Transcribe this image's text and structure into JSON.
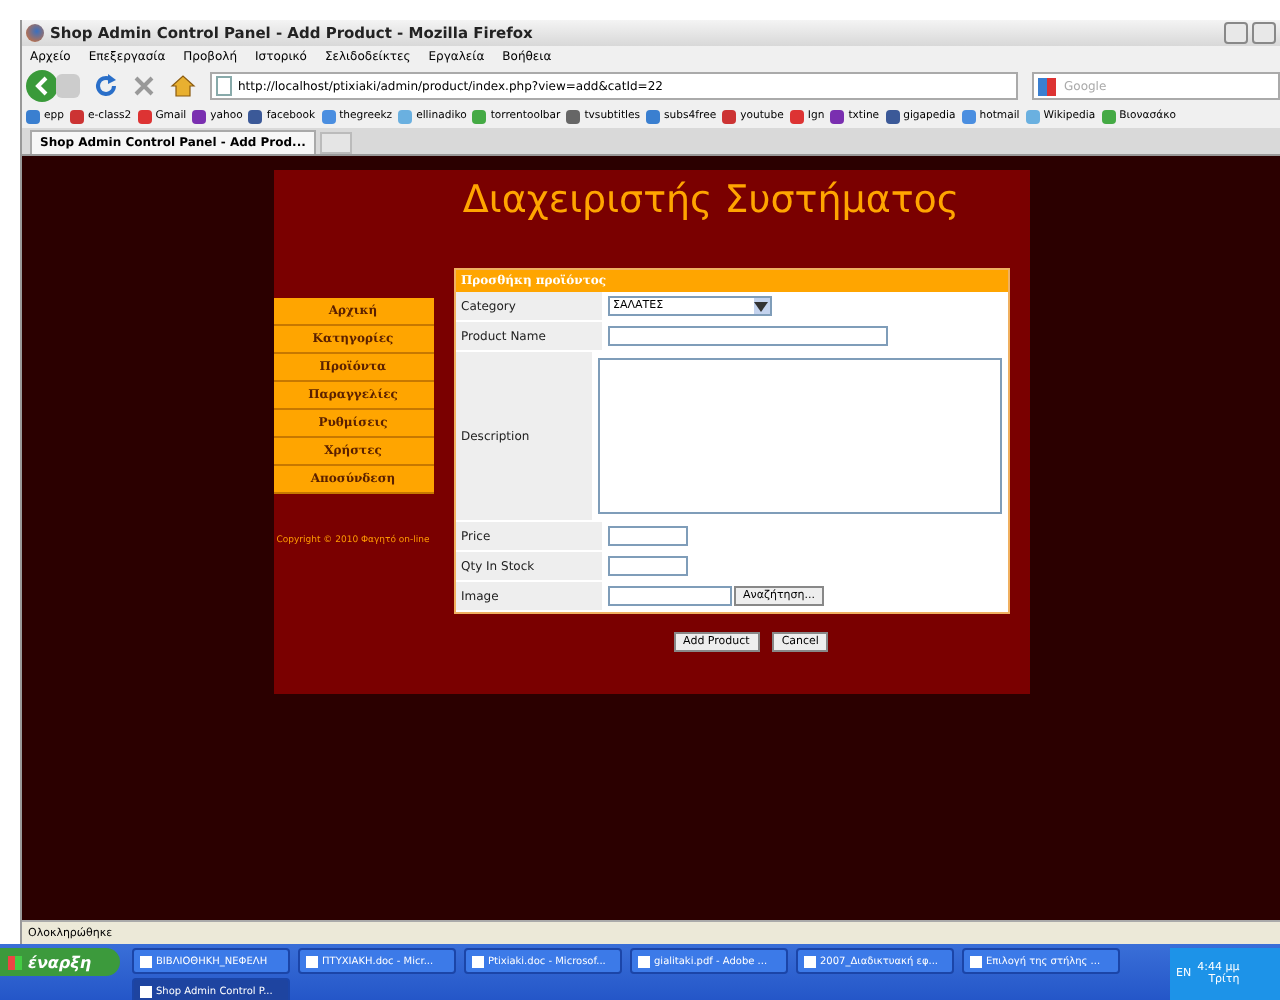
{
  "window": {
    "title": "Shop Admin Control Panel - Add Product - Mozilla Firefox"
  },
  "menu": [
    "Αρχείο",
    "Επεξεργασία",
    "Προβολή",
    "Ιστορικό",
    "Σελιδοδείκτες",
    "Εργαλεία",
    "Βοήθεια"
  ],
  "address": "http://localhost/ptixiaki/admin/product/index.php?view=add&catId=22",
  "search": {
    "placeholder": "Google"
  },
  "bookmarks": [
    "epp",
    "e-class2",
    "Gmail",
    "yahoo",
    "facebook",
    "thegreekz",
    "ellinadiko",
    "torrentoolbar",
    "tvsubtitles",
    "subs4free",
    "youtube",
    "Ign",
    "txtine",
    "gigapedia",
    "hotmail",
    "Wikipedia",
    "Βιονασάκο"
  ],
  "tabs": [
    {
      "label": "Shop Admin Control Panel - Add Prod...",
      "selected": true
    }
  ],
  "page": {
    "title": "Διαχειριστής Συστήματος",
    "nav": [
      "Αρχική",
      "Κατηγορίες",
      "Προϊόντα",
      "Παραγγελίες",
      "Ρυθμίσεις",
      "Χρήστες",
      "Αποσύνδεση"
    ],
    "copyright": "Copyright © 2010 Φαγητό on-line",
    "form": {
      "header": "Προσθήκη προϊόντος",
      "fields": [
        {
          "label": "Category",
          "kind": "select",
          "value": "ΣΑΛΑΤΕΣ"
        },
        {
          "label": "Product Name",
          "kind": "text"
        },
        {
          "label": "Description",
          "kind": "textarea"
        },
        {
          "label": "Price",
          "kind": "short"
        },
        {
          "label": "Qty In Stock",
          "kind": "short"
        },
        {
          "label": "Image",
          "kind": "file",
          "button": "Αναζήτηση..."
        }
      ]
    },
    "buttons": [
      "Add Product",
      "Cancel"
    ]
  },
  "status_bar": "Ολοκληρώθηκε",
  "taskbar": {
    "start": "έναρξη",
    "tasks": [
      "ΒΙΒΛΙΟΘΗΚΗ_ΝΕΦΕΛΗ",
      "ΠΤΥΧΙΑΚΗ.doc - Micr...",
      "Ptixiaki.doc - Microsof...",
      "gialitaki.pdf - Adobe ...",
      "2007_Διαδικτυακή εφ...",
      "Επιλογή της στήλης ...",
      "Shop Admin Control P..."
    ],
    "language": "EN",
    "time": "4:44 μμ",
    "day": "Τρίτη"
  }
}
